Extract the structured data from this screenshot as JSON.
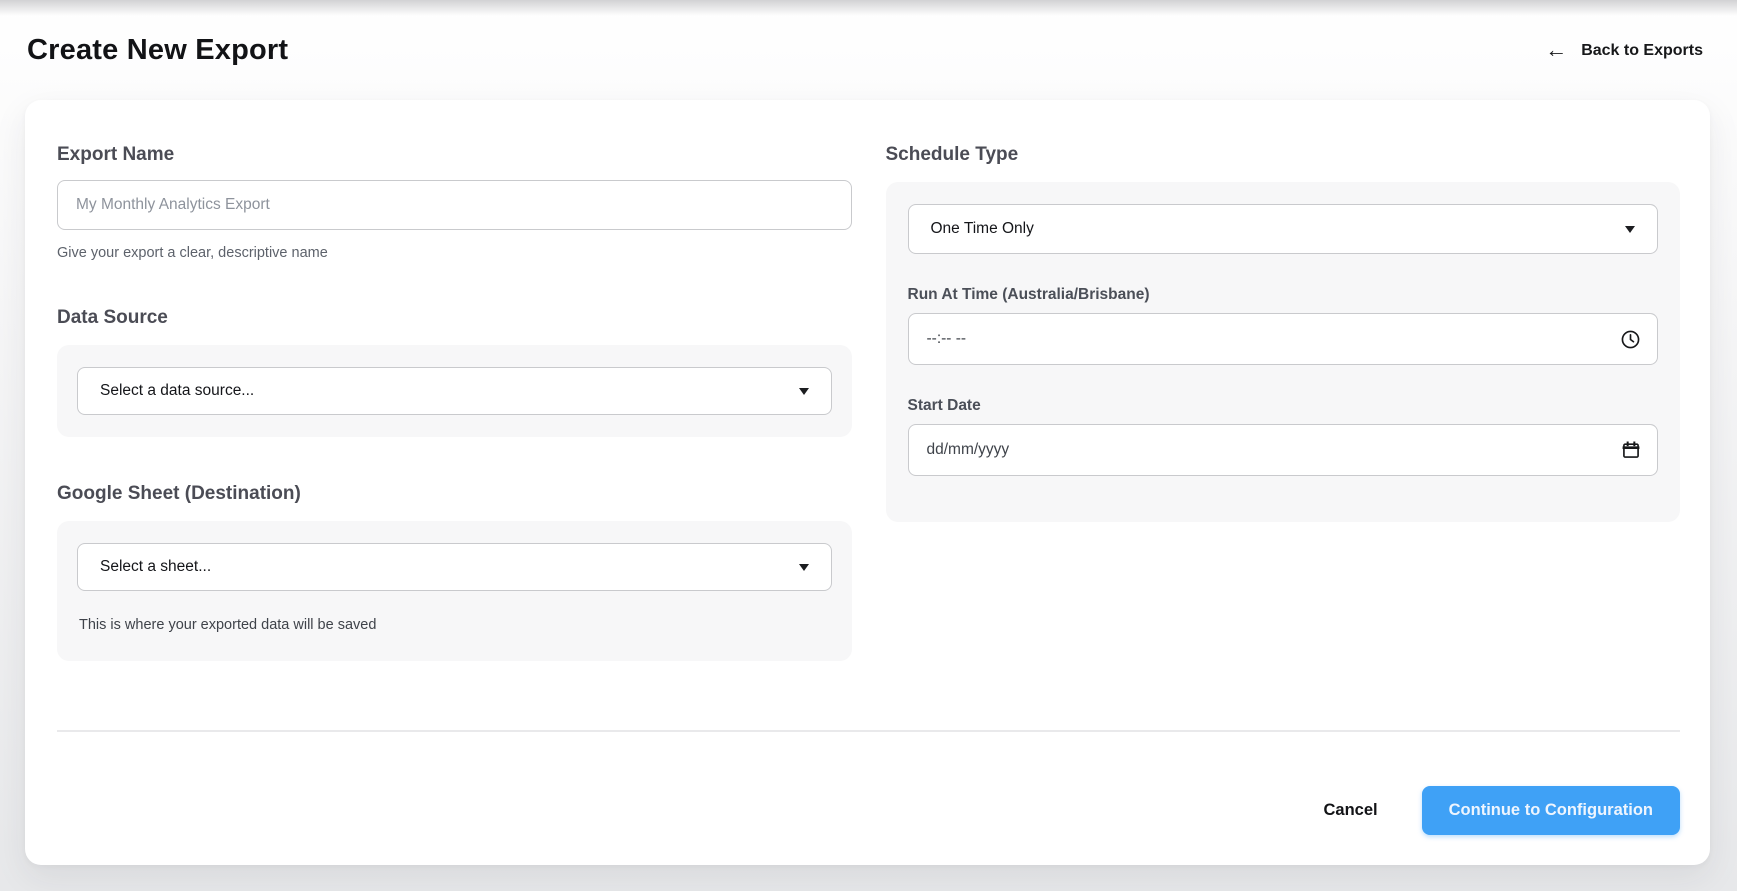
{
  "page": {
    "title": "Create New Export"
  },
  "header": {
    "back_icon": "←",
    "back_label": "Back to Exports"
  },
  "form": {
    "export_name": {
      "label": "Export Name",
      "placeholder": "My Monthly Analytics Export",
      "help": "Give your export a clear, descriptive name"
    },
    "data_source": {
      "label": "Data Source",
      "selected_value": "Select a data source..."
    },
    "google_sheet": {
      "label": "Google Sheet (Destination)",
      "selected_value": "Select a sheet...",
      "help": "This is where your exported data will be saved"
    },
    "schedule": {
      "label": "Schedule Type",
      "type_selected_value": "One Time Only",
      "run_at_label": "Run At Time (Australia/Brisbane)",
      "run_at_value": "--:-- --",
      "start_date_label": "Start Date",
      "start_date_value": "dd/mm/yyyy"
    }
  },
  "footer": {
    "cancel_label": "Cancel",
    "continue_label": "Continue to Configuration"
  },
  "icons": {
    "clock": "clock-icon",
    "calendar": "calendar-icon",
    "caret": "chevron-down-icon",
    "back": "arrow-left-icon"
  },
  "colors": {
    "primary_button_bg": "#3fa1f6",
    "card_bg": "#ffffff",
    "subcard_bg": "#f7f7f8",
    "input_border": "#c9cacd",
    "heading_text": "#4b4c55",
    "help_text": "#5d626b"
  }
}
